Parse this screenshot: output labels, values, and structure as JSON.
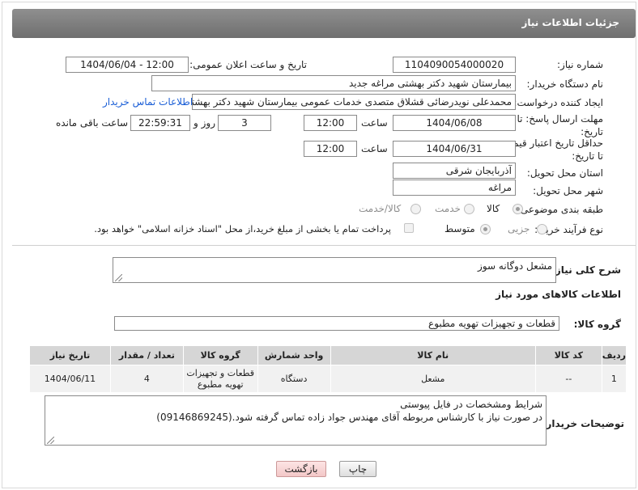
{
  "header": {
    "title": "جزئیات اطلاعات نیاز"
  },
  "form": {
    "need_number": {
      "label": "شماره نیاز:",
      "value": "1104090054000020"
    },
    "announce_datetime": {
      "label": "تاریخ و ساعت اعلان عمومی:",
      "value": "1404/06/04 - 12:00"
    },
    "buyer_org": {
      "label": "نام دستگاه خریدار:",
      "value": "بیمارستان شهید دکتر بهشتی مراغه جدید"
    },
    "requester": {
      "label": "ایجاد کننده درخواست:",
      "value": "محمدعلی نویدرضائی قشلاق متصدی خدمات عمومی بیمارستان شهید دکتر بهشتی",
      "contact_link": "اطلاعات تماس خریدار"
    },
    "reply_deadline": {
      "label_line1": "مهلت ارسال پاسخ: تا",
      "label_line2": "تاریخ:",
      "date": "1404/06/08",
      "time_label": "ساعت",
      "time": "12:00",
      "days": "3",
      "days_label": "روز و",
      "remaining": "22:59:31",
      "remaining_label": "ساعت باقی مانده"
    },
    "price_validity": {
      "label_line1": "حداقل تاریخ اعتبار قیمت:",
      "label_line2": "تا تاریخ:",
      "date": "1404/06/31",
      "time_label": "ساعت",
      "time": "12:00"
    },
    "province": {
      "label": "استان محل تحویل:",
      "value": "آذربایجان شرقی"
    },
    "city": {
      "label": "شهر محل تحویل:",
      "value": "مراغه"
    },
    "category": {
      "label": "طبقه بندی موضوعی:",
      "options": [
        "کالا",
        "خدمت",
        "کالا/خدمت"
      ],
      "selected": "کالا"
    },
    "process_type": {
      "label": "نوع فرآیند خرید :",
      "options": [
        "جزیی",
        "متوسط"
      ],
      "selected": "متوسط",
      "note": "پرداخت تمام یا بخشی از مبلغ خرید،از محل \"اسناد خزانه اسلامی\" خواهد بود."
    }
  },
  "summary": {
    "label": "شرح کلی نیاز:",
    "value": "مشعل دوگانه سوز"
  },
  "goods_section": {
    "title": "اطلاعات کالاهای مورد نیاز",
    "group_label": "گروه کالا:",
    "group_value": "قطعات و تجهیزات تهویه مطبوع"
  },
  "table": {
    "headers": [
      "ردیف",
      "کد کالا",
      "نام کالا",
      "واحد شمارش",
      "گروه کالا",
      "تعداد / مقدار",
      "تاریخ نیاز"
    ],
    "rows": [
      {
        "row": "1",
        "code": "--",
        "name": "مشعل",
        "unit": "دستگاه",
        "group": "قطعات و تجهیزات تهویه مطبوع",
        "qty": "4",
        "date": "1404/06/11"
      }
    ]
  },
  "buyer_notes": {
    "label": "توضیحات خریدار:",
    "line1": "شرایط ومشخصات در فایل پیوستی",
    "line2": "در صورت نیاز با کارشناس مربوطه آقای مهندس جواد زاده تماس گرفته شود.(09146869245)"
  },
  "buttons": {
    "print": "چاپ",
    "back": "بازگشت"
  },
  "colors": {
    "header_bg": "#7f7f7f",
    "link": "#1a5ed6",
    "table_header": "#d6d6d6",
    "back_button": "#f3c8c8"
  }
}
